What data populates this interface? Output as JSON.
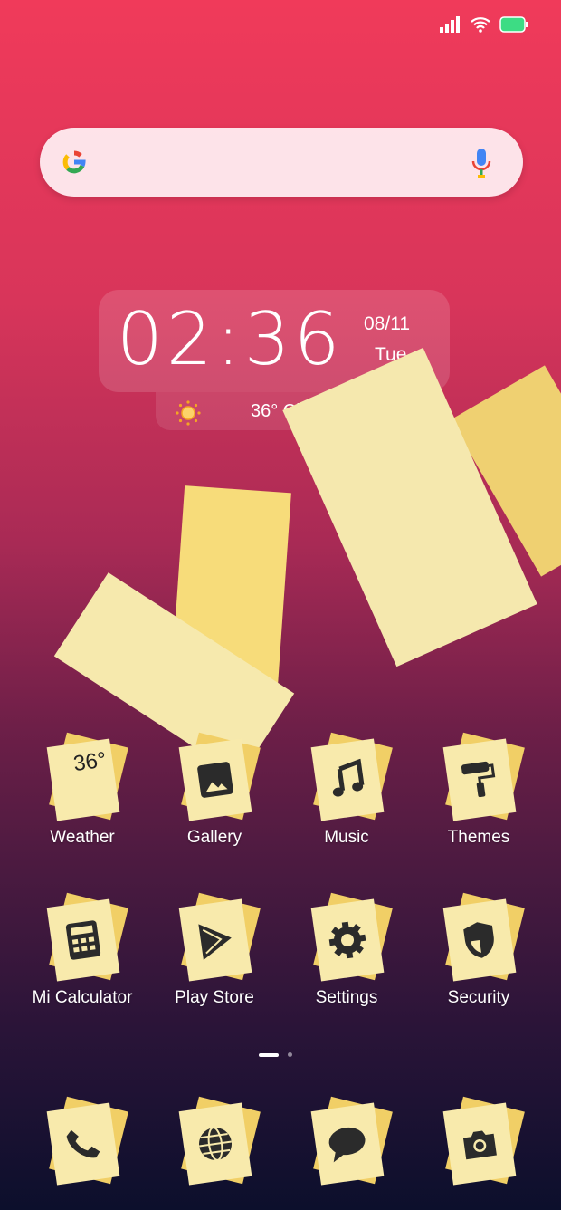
{
  "status_bar": {
    "icons": [
      "signal-icon",
      "wifi-icon",
      "battery-icon"
    ],
    "battery_color": "#3ddc84"
  },
  "search": {
    "logo": "google-logo",
    "mic": "mic-icon"
  },
  "clock": {
    "time": "02:36",
    "date": "08/11",
    "day": "Tue"
  },
  "weather": {
    "text": "36° Clear",
    "icon": "sun-icon"
  },
  "apps_row1": [
    {
      "label": "Weather",
      "badge": "36°"
    },
    {
      "label": "Gallery"
    },
    {
      "label": "Music"
    },
    {
      "label": "Themes"
    }
  ],
  "apps_row2": [
    {
      "label": "Mi Calculator"
    },
    {
      "label": "Play Store"
    },
    {
      "label": "Settings"
    },
    {
      "label": "Security"
    }
  ],
  "dock": [
    {
      "icon": "phone-icon"
    },
    {
      "icon": "browser-icon"
    },
    {
      "icon": "messages-icon"
    },
    {
      "icon": "camera-icon"
    }
  ],
  "page_indicator": {
    "pages": 2,
    "current": 1
  }
}
